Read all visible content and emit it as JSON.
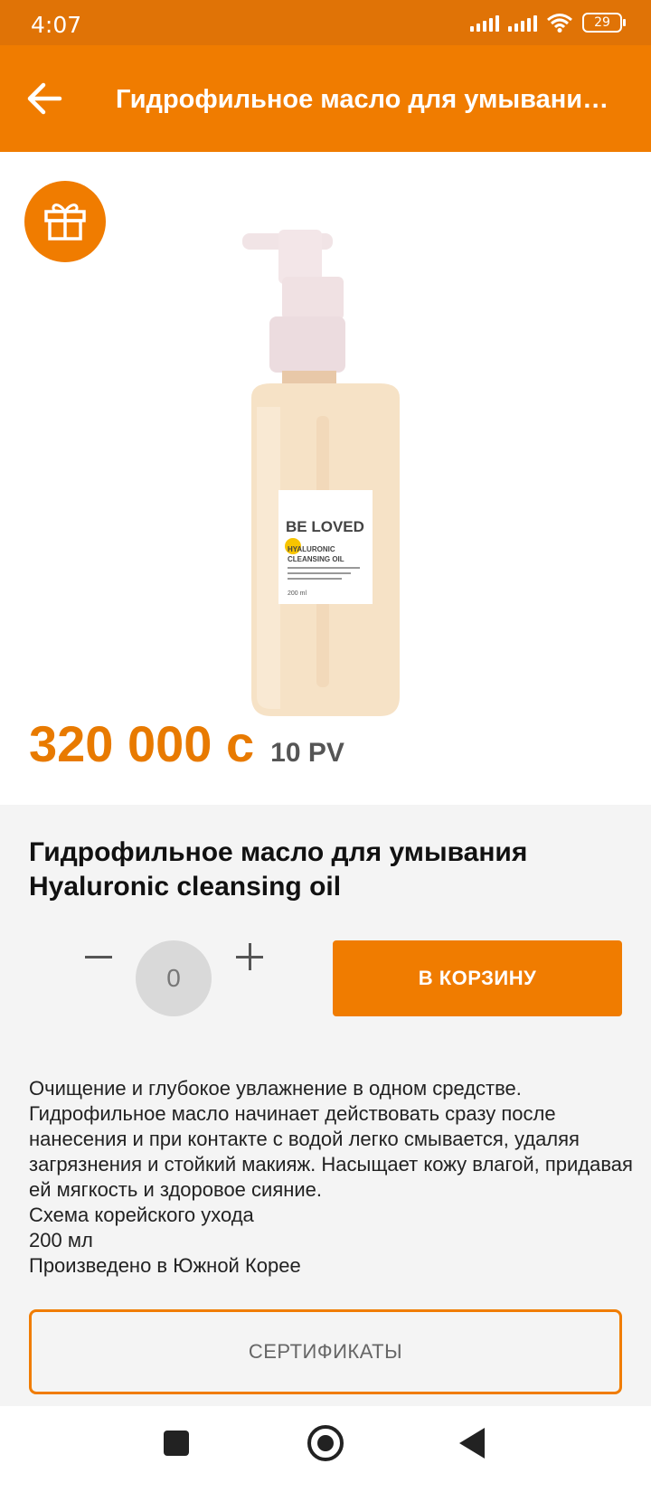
{
  "status_bar": {
    "time": "4:07",
    "battery": "29"
  },
  "app_bar": {
    "title": "Гидрофильное масло для умывания Hyaluronic cleansing oil",
    "back_icon": "arrow-back-icon"
  },
  "product": {
    "badge_icon": "gift-icon",
    "image_label": {
      "brand": "BE LOVED",
      "line1": "HYALURONIC",
      "line2": "CLEANSING OIL",
      "volume": "200 ml"
    },
    "price": "320 000 с",
    "pv": "10 PV",
    "name": "Гидрофильное масло для умывания Hyaluronic cleansing oil"
  },
  "quantity": {
    "value": "0",
    "minus_icon": "minus-icon",
    "plus_icon": "plus-icon"
  },
  "cart_button": "В КОРЗИНУ",
  "description": [
    "Очищение и глубокое увлажнение в одном средстве. Гидрофильное масло начинает действовать сразу после нанесения и при контакте с водой легко смывается, удаляя загрязнения и стойкий макияж. Насыщает кожу влагой, придавая ей мягкость и здоровое сияние.",
    "Схема корейского ухода",
    "200 мл",
    "Произведено в Южной Корее"
  ],
  "certificates_button": "СЕРТИФИКАТЫ",
  "colors": {
    "accent": "#f07c00",
    "status_bar": "#e07306",
    "price": "#e87a00"
  }
}
